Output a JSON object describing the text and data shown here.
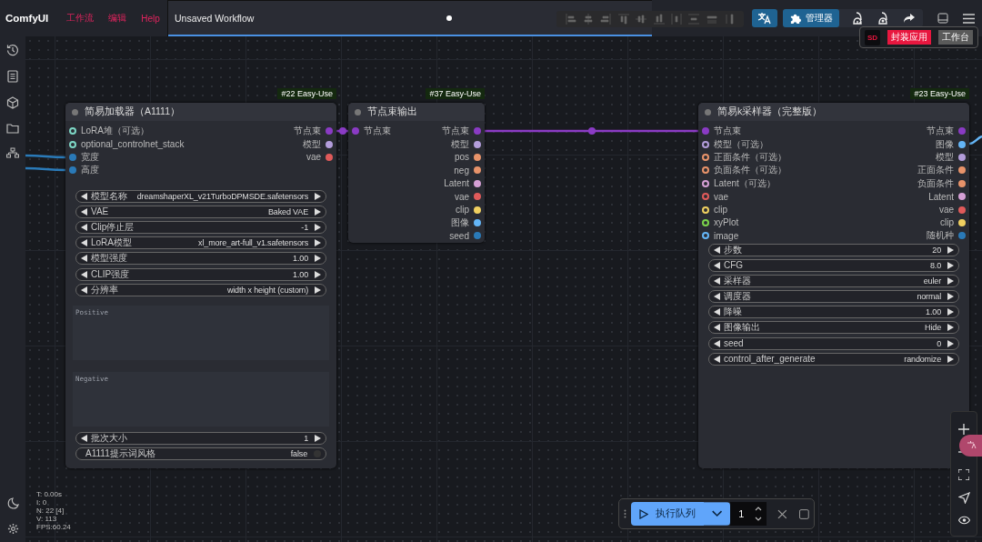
{
  "menu": {
    "logo": "ComfyUI",
    "items": [
      "工作流",
      "编辑",
      "Help"
    ]
  },
  "tabs": [
    {
      "label": "Unsaved Workflow",
      "selected": true,
      "unsaved": true
    }
  ],
  "actions": {
    "manager": "管理器"
  },
  "popup": {
    "logo": "SD",
    "buttons": [
      {
        "label": "封装应用",
        "kind": "primary"
      },
      {
        "label": "工作台",
        "kind": "secondary"
      }
    ]
  },
  "nodes": [
    {
      "badge": "#22 Easy-Use",
      "title": "简易加载器（A1111）",
      "inputs": [
        {
          "label": "LoRA堆（可选）",
          "color": "#7ed8c6",
          "connected": false
        },
        {
          "label": "optional_controlnet_stack",
          "color": "#7ed8c6",
          "connected": false
        },
        {
          "label": "宽度",
          "color": "#2a7ab8",
          "connected": true
        },
        {
          "label": "高度",
          "color": "#2a7ab8",
          "connected": true
        }
      ],
      "outputs": [
        {
          "label": "节点束",
          "color": "#8a3bc4"
        },
        {
          "label": "模型",
          "color": "#b39ddb"
        },
        {
          "label": "vae",
          "color": "#e05a5a"
        }
      ],
      "widgets": [
        {
          "kind": "combo",
          "label": "模型名称",
          "value": "dreamshaperXL_v21TurboDPMSDE.safetensors"
        },
        {
          "kind": "combo",
          "label": "VAE",
          "value": "Baked VAE"
        },
        {
          "kind": "combo",
          "label": "Clip停止层",
          "value": "-1"
        },
        {
          "kind": "combo",
          "label": "LoRA模型",
          "value": "xl_more_art-full_v1.safetensors"
        },
        {
          "kind": "combo",
          "label": "模型强度",
          "value": "1.00"
        },
        {
          "kind": "combo",
          "label": "CLIP强度",
          "value": "1.00"
        },
        {
          "kind": "combo",
          "label": "分辨率",
          "value": "width x height (custom)"
        },
        {
          "kind": "textarea",
          "placeholder": "Positive"
        },
        {
          "kind": "textarea",
          "placeholder": "Negative"
        },
        {
          "kind": "combo",
          "label": "批次大小",
          "value": "1"
        },
        {
          "kind": "toggle",
          "label": "A1111提示词风格",
          "value": "false",
          "on": false
        }
      ]
    },
    {
      "badge": "#37 Easy-Use",
      "title": "节点束输出",
      "inputs": [
        {
          "label": "节点束",
          "color": "#8a3bc4",
          "connected": true
        }
      ],
      "outputs": [
        {
          "label": "节点束",
          "color": "#8a3bc4"
        },
        {
          "label": "模型",
          "color": "#b39ddb"
        },
        {
          "label": "pos",
          "color": "#e8936a"
        },
        {
          "label": "neg",
          "color": "#e8936a"
        },
        {
          "label": "Latent",
          "color": "#d6a0d6"
        },
        {
          "label": "vae",
          "color": "#e05a5a"
        },
        {
          "label": "clip",
          "color": "#f0d060"
        },
        {
          "label": "图像",
          "color": "#64b5f6"
        },
        {
          "label": "seed",
          "color": "#2a7ab8"
        }
      ]
    },
    {
      "badge": "#23 Easy-Use",
      "title": "简易k采样器（完整版）",
      "inputs": [
        {
          "label": "节点束",
          "color": "#8a3bc4",
          "connected": true
        },
        {
          "label": "模型（可选）",
          "color": "#b39ddb",
          "connected": false
        },
        {
          "label": "正面条件（可选）",
          "color": "#e8936a",
          "connected": false
        },
        {
          "label": "负面条件（可选）",
          "color": "#e8936a",
          "connected": false
        },
        {
          "label": "Latent（可选）",
          "color": "#d6a0d6",
          "connected": false
        },
        {
          "label": "vae",
          "color": "#e05a5a",
          "connected": false
        },
        {
          "label": "clip",
          "color": "#f0d060",
          "connected": false
        },
        {
          "label": "xyPlot",
          "color": "#7bd44b",
          "connected": false
        },
        {
          "label": "image",
          "color": "#64b5f6",
          "connected": false
        }
      ],
      "outputs": [
        {
          "label": "节点束",
          "color": "#8a3bc4"
        },
        {
          "label": "图像",
          "color": "#64b5f6"
        },
        {
          "label": "模型",
          "color": "#b39ddb"
        },
        {
          "label": "正面条件",
          "color": "#e8936a"
        },
        {
          "label": "负面条件",
          "color": "#e8936a"
        },
        {
          "label": "Latent",
          "color": "#d6a0d6"
        },
        {
          "label": "vae",
          "color": "#e05a5a"
        },
        {
          "label": "clip",
          "color": "#f0d060"
        },
        {
          "label": "随机种",
          "color": "#2a7ab8"
        }
      ],
      "widgets": [
        {
          "kind": "combo",
          "label": "步数",
          "value": "20"
        },
        {
          "kind": "combo",
          "label": "CFG",
          "value": "8.0"
        },
        {
          "kind": "combo",
          "label": "采样器",
          "value": "euler"
        },
        {
          "kind": "combo",
          "label": "调度器",
          "value": "normal"
        },
        {
          "kind": "combo",
          "label": "降噪",
          "value": "1.00"
        },
        {
          "kind": "combo",
          "label": "图像输出",
          "value": "Hide"
        },
        {
          "kind": "combo",
          "label": "seed",
          "value": "0"
        },
        {
          "kind": "combo",
          "label": "control_after_generate",
          "value": "randomize"
        }
      ]
    }
  ],
  "stats": [
    "T: 0.00s",
    "I: 0",
    "N: 22 [4]",
    "V: 113",
    "FPS:60.24"
  ],
  "queue": {
    "run": "执行队列",
    "count": "1"
  }
}
